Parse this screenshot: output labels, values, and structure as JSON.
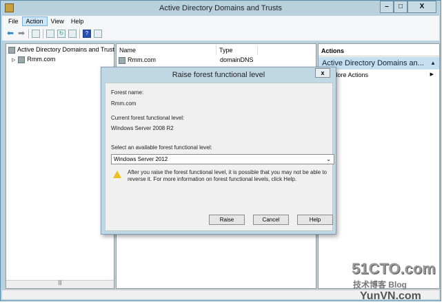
{
  "window": {
    "title": "Active Directory Domains and Trusts",
    "minimize": "–",
    "maximize": "□",
    "close": "X"
  },
  "menu": [
    "File",
    "Action",
    "View",
    "Help"
  ],
  "toolbar": {
    "icons": [
      "back-arrow-icon",
      "forward-arrow-icon",
      "show-hide-console-tree-icon",
      "properties-icon",
      "refresh-icon",
      "export-list-icon",
      "help-icon",
      "show-hide-action-pane-icon"
    ],
    "help_glyph": "?"
  },
  "tree": {
    "root": "Active Directory Domains and Trust",
    "child": "Rmm.com",
    "expander": "▷"
  },
  "list": {
    "columns": [
      "Name",
      "Type"
    ],
    "rows": [
      {
        "name": "Rmm.com",
        "type": "domainDNS"
      }
    ],
    "scroll": "|||"
  },
  "actions": {
    "header": "Actions",
    "selected": "Active Directory Domains an...",
    "selected_arrow": "▲",
    "more": "More Actions",
    "more_arrow": "▶"
  },
  "dialog": {
    "title": "Raise forest functional level",
    "close": "x",
    "forest_name_label": "Forest name:",
    "forest_name": "Rmm.com",
    "current_level_label": "Current forest functional level:",
    "current_level": "Windows Server 2008 R2",
    "select_label": "Select an available forest functional level:",
    "selected_level": "Windows Server 2012",
    "warning": "After you raise the forest functional level, it is possible that you may not be able to reverse it. For more information on forest functional levels, click Help.",
    "buttons": {
      "raise": "Raise",
      "cancel": "Cancel",
      "help": "Help"
    }
  },
  "watermark": {
    "line1": "51CTO.com",
    "line2": "技术博客 Blog",
    "line3": "YunVN.com"
  }
}
